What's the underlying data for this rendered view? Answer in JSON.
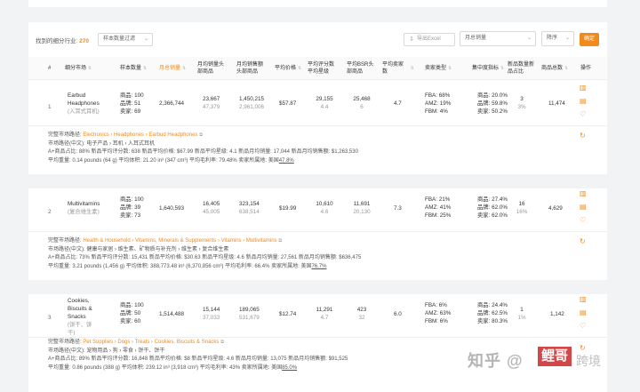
{
  "toolbar": {
    "found_prefix": "找到的细分行业:",
    "found_count": "270",
    "filter_select": "样本数量过滤",
    "export_label": "导出Excel",
    "sort_field": "月总销量",
    "sort_order": "降序",
    "confirm_label": "确定"
  },
  "columns": [
    "#",
    "细分市场",
    "样本数量",
    "月总销量",
    "月均销量头部商品",
    "月均销售额头部商品",
    "平均价格",
    "平均评分数平均星级",
    "平均BSR头部商品",
    "平均卖家数",
    "卖家类型",
    "集中度指标",
    "新品数量新品占比",
    "商品总数",
    "操作"
  ],
  "rows": [
    {
      "index": "1",
      "name": "Earbud Headphones",
      "name_cn": "(入耳式耳机)",
      "samples": [
        "商品: 100",
        "品牌: 51",
        "卖家: 69"
      ],
      "monthly_sales": "2,366,744",
      "avg_units": "23,667",
      "avg_units_sub": "47,379",
      "avg_revenue": "1,450,215",
      "avg_revenue_sub": "2,961,006",
      "avg_price": "$57.87",
      "rating_count": "29,155",
      "rating_star": "4.4",
      "bsr": "25,468",
      "bsr_sub": "6",
      "sellers": "4.7",
      "seller_types": [
        "FBA: 68%",
        "AMZ: 19%",
        "FBM: 4%"
      ],
      "concentration": [
        "商品: 20.0%",
        "品牌: 59.8%",
        "卖家: 50.2%"
      ],
      "new_count": "3",
      "new_ratio": "3%",
      "total": "11,474",
      "path_label": "完整市场路径:",
      "path": "Electronics › Headphones › Earbud Headphones",
      "path_cn": "市场路径(中文): 电子产品 › 耳机 › 入耳式耳机",
      "metrics1": "A+商品占比: 88%    新品平均评分数: 638    新品平均价格: $67.99    新品平均星级: 4.1    新品月均销量: 17,044    新品月均销售额: $1,263,530",
      "metrics2_a": "平均重量: 0.14 pounds (64 g)    平均体积: 21.20 in³ (347 cm³)    平均毛利率: 79.48%    卖家所属地: 美国",
      "metrics2_b": "47.8%"
    },
    {
      "index": "2",
      "name": "Multivitamins",
      "name_cn": "(复合维生素)",
      "samples": [
        "商品: 100",
        "品牌: 39",
        "卖家: 73"
      ],
      "monthly_sales": "1,640,593",
      "avg_units": "16,405",
      "avg_units_sub": "45,005",
      "avg_revenue": "323,154",
      "avg_revenue_sub": "638,514",
      "avg_price": "$19.99",
      "rating_count": "10,610",
      "rating_star": "4.6",
      "bsr": "11,691",
      "bsr_sub": "20,130",
      "sellers": "7.3",
      "seller_types": [
        "FBA: 21%",
        "AMZ: 41%",
        "FBM: 25%"
      ],
      "concentration": [
        "商品: 27.4%",
        "品牌: 62.0%",
        "卖家: 62.0%"
      ],
      "new_count": "16",
      "new_ratio": "16%",
      "total": "4,629",
      "path_label": "完整市场路径:",
      "path": "Health & Household › Vitamins, Minerals & Supplements › Vitamins › Multivitamins",
      "path_cn": "市场路径(中文): 健康与家居 › 维生素、矿物质与补充剂 › 维生素 › 复合维生素",
      "metrics1": "A+商品占比: 73%    新品平均评分数: 15,431    新品平均价格: $30.63    新品平均星级: 4.6    新品月均销量: 27,561    新品月均销售额: $636,475",
      "metrics2_a": "平均重量: 3.21 pounds (1,456 g)    平均体积: 388,773.48 in³ (6,370,856 cm³)    平均毛利率: 66.4%    卖家所属地: 美国",
      "metrics2_b": "76.7%"
    },
    {
      "index": "3",
      "name": "Cookies, Biscuits & Snacks",
      "name_cn": "(饼干、饼干)",
      "samples": [
        "商品: 100",
        "品牌: 50",
        "卖家: 60"
      ],
      "monthly_sales": "1,514,488",
      "avg_units": "15,144",
      "avg_units_sub": "37,033",
      "avg_revenue": "189,065",
      "avg_revenue_sub": "531,679",
      "avg_price": "$12.74",
      "rating_count": "11,291",
      "rating_star": "4.7",
      "bsr": "423",
      "bsr_sub": "32",
      "sellers": "6.0",
      "seller_types": [
        "FBA: 6%",
        "AMZ: 63%",
        "FBM: 6%"
      ],
      "concentration": [
        "商品: 24.4%",
        "品牌: 62.5%",
        "卖家: 80.3%"
      ],
      "new_count": "1",
      "new_ratio": "1%",
      "total": "1,142",
      "path_label": "完整市场路径:",
      "path": "Pet Supplies › Dogs › Treats › Cookies, Biscuits & Snacks",
      "path_cn": "市场路径(中文): 宠物用品 › 狗 › 零食 › 饼干、饼干",
      "metrics1": "A+商品占比: 89%    新品平均评分数: 16,848    新品平均价格: $8    新品平均星级: 4.6    新品月均销量: 13,075    新品月均销售额: $91,525",
      "metrics2_a": "平均重量: 0.86 pounds (388 g)    平均体积: 239.12 in³ (3,918 cm³)    平均毛利率: 43%    卖家所属地: 美国",
      "metrics2_b": "85.0%"
    }
  ],
  "watermark": {
    "text1": "知乎",
    "text2": "@",
    "box": "鲤哥",
    "text3": "跨境"
  }
}
